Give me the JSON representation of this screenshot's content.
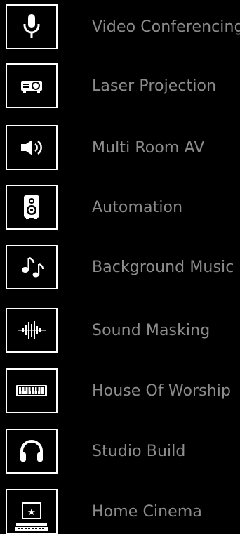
{
  "menu": {
    "items": [
      {
        "label": "Video Conferencing",
        "icon": "microphone-icon"
      },
      {
        "label": "Laser Projection",
        "icon": "projector-icon"
      },
      {
        "label": "Multi Room AV",
        "icon": "speaker-volume-icon"
      },
      {
        "label": "Automation",
        "icon": "loudspeaker-icon"
      },
      {
        "label": "Background Music",
        "icon": "music-notes-icon"
      },
      {
        "label": "Sound Masking",
        "icon": "sound-wave-icon"
      },
      {
        "label": "House Of Worship",
        "icon": "keyboard-piano-icon"
      },
      {
        "label": "Studio Build",
        "icon": "headphones-icon"
      },
      {
        "label": "Home Cinema",
        "icon": "cinema-screen-icon"
      }
    ]
  },
  "colors": {
    "background": "#000000",
    "icon": "#ffffff",
    "label": "#8c8c8c"
  }
}
